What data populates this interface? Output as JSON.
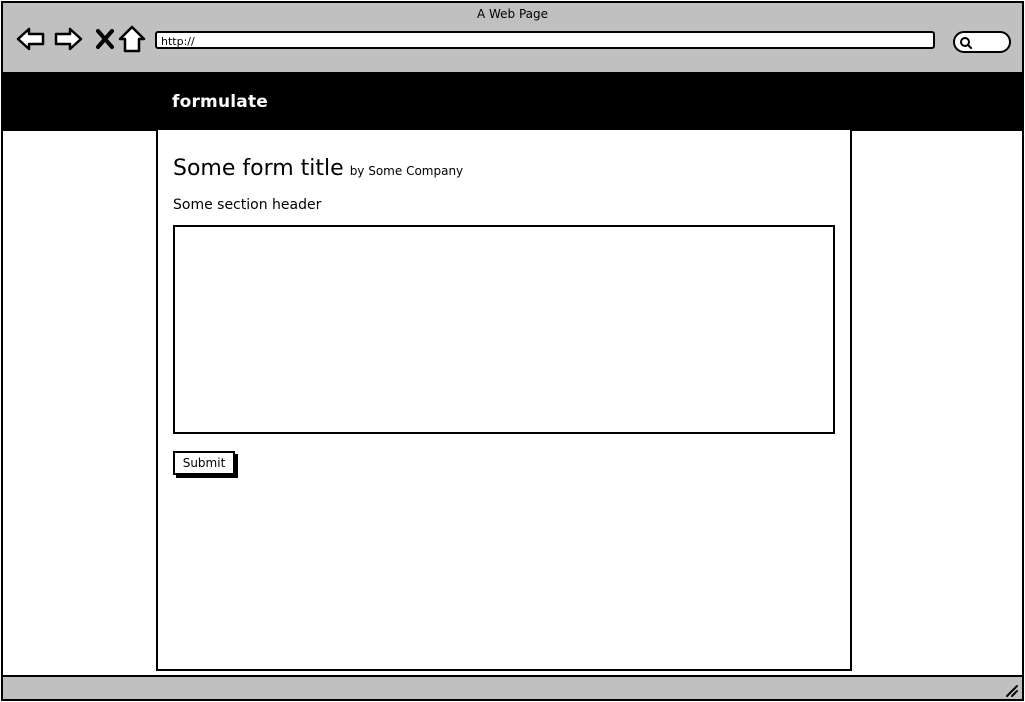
{
  "window": {
    "title": "A Web Page"
  },
  "toolbar": {
    "back_icon": "back-arrow-icon",
    "forward_icon": "forward-arrow-icon",
    "stop_icon": "close-icon",
    "home_icon": "home-icon",
    "url": "http://",
    "search_icon": "search-icon"
  },
  "header": {
    "brand": "formulate"
  },
  "form": {
    "title": "Some form title",
    "byline": "by Some Company",
    "section_header": "Some section header",
    "textarea_value": "",
    "submit_label": "Submit"
  },
  "colors": {
    "chrome": "#c0c0c0",
    "header_bg": "#000000",
    "header_text": "#ffffff",
    "page_bg": "#ffffff"
  }
}
